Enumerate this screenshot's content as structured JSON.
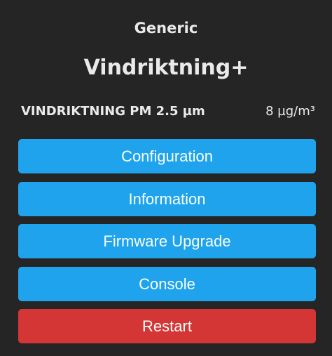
{
  "header": {
    "device_type": "Generic",
    "device_name": "Vindriktning+"
  },
  "sensor": {
    "label": "VINDRIKTNING PM 2.5 µm",
    "value": "8 µg/m³"
  },
  "menu": {
    "configuration": "Configuration",
    "information": "Information",
    "firmware_upgrade": "Firmware Upgrade",
    "console": "Console",
    "restart": "Restart"
  },
  "colors": {
    "background": "#252525",
    "button": "#1fa3ec",
    "button_danger": "#d43535",
    "text": "#eaeaea"
  }
}
